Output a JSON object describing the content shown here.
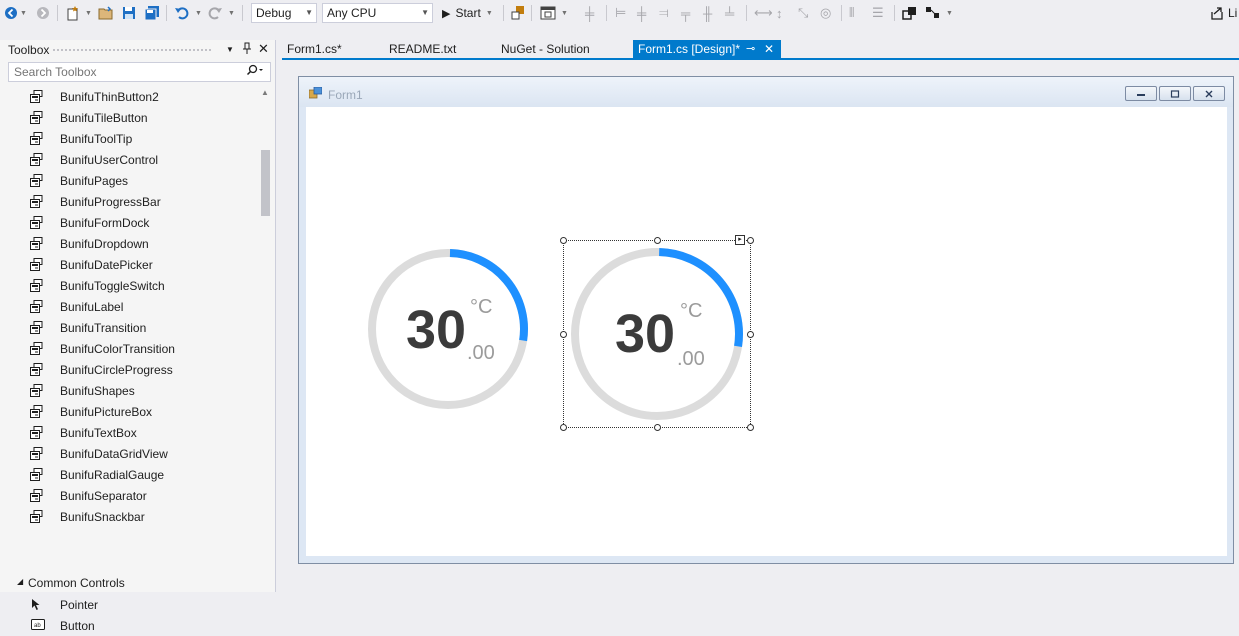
{
  "toolbar": {
    "config": "Debug",
    "platform": "Any CPU",
    "start_label": "Start",
    "right_label": "Li"
  },
  "toolbox": {
    "title": "Toolbox",
    "search_placeholder": "Search Toolbox",
    "items": [
      "BunifuThinButton2",
      "BunifuTileButton",
      "BunifuToolTip",
      "BunifuUserControl",
      "BunifuPages",
      "BunifuProgressBar",
      "BunifuFormDock",
      "BunifuDropdown",
      "BunifuDatePicker",
      "BunifuToggleSwitch",
      "BunifuLabel",
      "BunifuTransition",
      "BunifuColorTransition",
      "BunifuCircleProgress",
      "BunifuShapes",
      "BunifuPictureBox",
      "BunifuTextBox",
      "BunifuDataGridView",
      "BunifuRadialGauge",
      "BunifuSeparator",
      "BunifuSnackbar"
    ],
    "group_label": "Common Controls",
    "common_items": [
      "Pointer",
      "Button"
    ]
  },
  "tabs": [
    "Form1.cs*",
    "README.txt",
    "NuGet - Solution",
    "Form1.cs [Design]*"
  ],
  "form": {
    "title": "Form1",
    "gauges": [
      {
        "value": "30",
        "unit": "°C",
        "decimals": ".00",
        "progress": 0.27
      },
      {
        "value": "30",
        "unit": "°C",
        "decimals": ".00",
        "progress": 0.27
      }
    ]
  },
  "colors": {
    "accent": "#007acc",
    "gauge_track": "#dcdcdc",
    "gauge_fill": "#1e90ff"
  }
}
